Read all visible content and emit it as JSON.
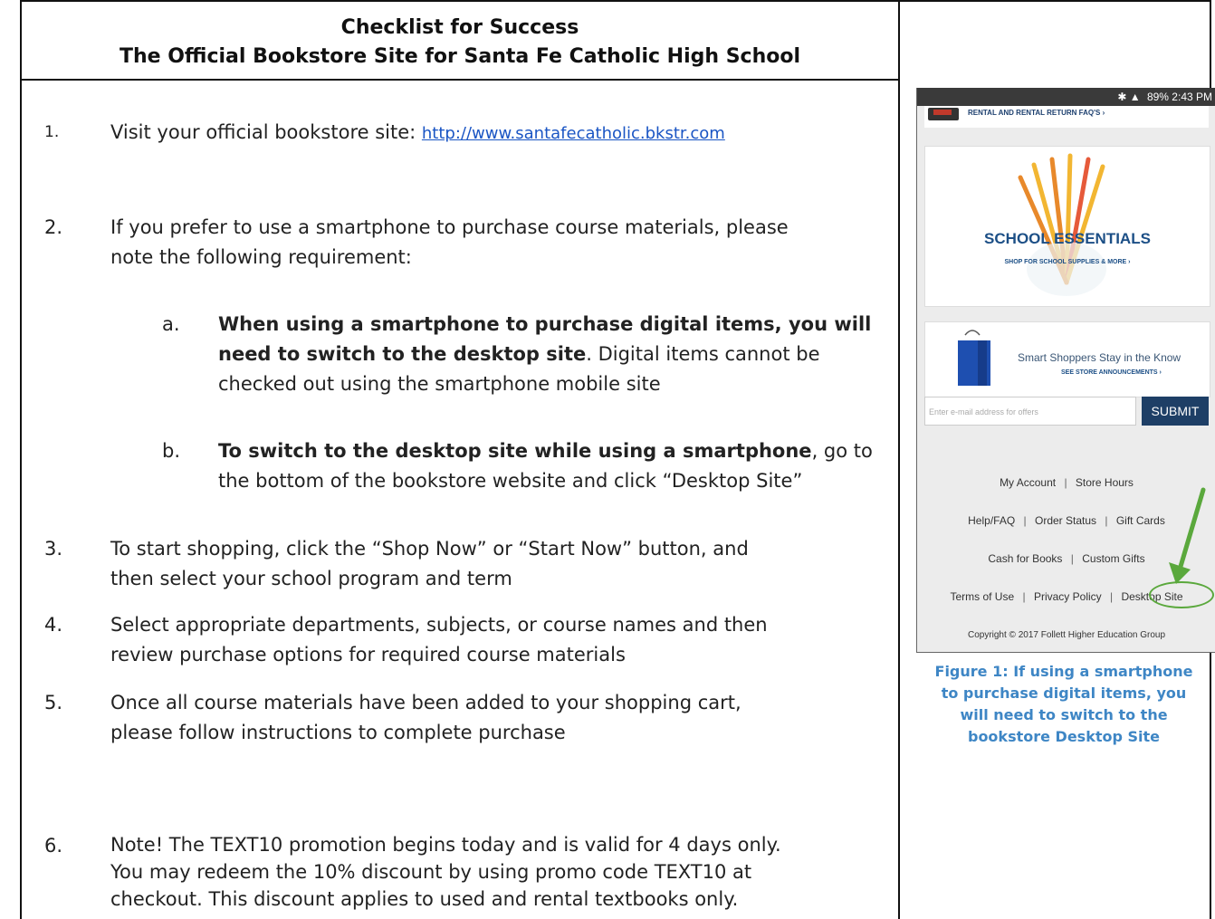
{
  "header": {
    "title_line1": "Checklist for Success",
    "title_line2": "The Official Bookstore Site for Santa Fe Catholic High School"
  },
  "steps": [
    {
      "num": "1.",
      "text": "Visit your official bookstore site: ",
      "link": "http://www.santafecatholic.bkstr.com"
    },
    {
      "num": "2.",
      "line1": "If you prefer to use a smartphone to purchase course materials, please",
      "line2": "note the following requirement:"
    },
    {
      "num": "3.",
      "line1": "To start shopping, click the “Shop Now” or “Start Now” button, and",
      "line2": "then select your school program and term"
    },
    {
      "num": "4.",
      "line1": "Select appropriate departments, subjects, or course names and then",
      "line2": "review purchase options for required course materials"
    },
    {
      "num": "5.",
      "line1": "Once all course materials have been added to your shopping cart,",
      "line2": "please follow instructions to complete purchase"
    },
    {
      "num": "6.",
      "line1": "Note! The TEXT10 promotion begins today and is valid for 4 days only.",
      "line2": "You may redeem the 10% discount by using promo code TEXT10 at",
      "line3": "checkout. This discount applies to used and rental textbooks only."
    }
  ],
  "substeps": [
    {
      "letter": "a.",
      "bold1": "When using a smartphone to purchase digital items, you will",
      "bold2": "need to switch to the desktop site",
      "rest2": ". Digital items cannot be",
      "line3": "checked out using the smartphone mobile site"
    },
    {
      "letter": "b.",
      "bold1": "To switch to the desktop site while using a smartphone",
      "rest1": ", go  to",
      "line2": "the bottom of the bookstore website and click “Desktop Site”"
    }
  ],
  "phone": {
    "status": "89% 2:43 PM",
    "banner_top": "RENTAL AND RENTAL RETURN FAQ'S ›",
    "essentials_title": "SCHOOL ESSENTIALS",
    "essentials_sub": "SHOP FOR SCHOOL SUPPLIES & MORE ›",
    "smart_title": "Smart Shoppers Stay in the Know",
    "smart_sub": "SEE STORE ANNOUNCEMENTS ›",
    "email_placeholder": "Enter e-mail address for offers",
    "submit_label": "SUBMIT",
    "footer_links": {
      "my_account": "My Account",
      "store_hours": "Store Hours",
      "help_faq": "Help/FAQ",
      "order_status": "Order Status",
      "gift_cards": "Gift Cards",
      "cash_for_books": "Cash for Books",
      "custom_gifts": "Custom Gifts",
      "terms": "Terms of Use",
      "privacy": "Privacy Policy",
      "desktop_site": "Desktop Site"
    },
    "separator": "|",
    "copyright": "Copyright © 2017 Follett Higher Education Group"
  },
  "caption": {
    "line1": "Figure 1: If using a smartphone",
    "line2": "to purchase digital items, you",
    "line3": "will need to switch to the",
    "line4": "bookstore Desktop Site"
  },
  "colors": {
    "link": "#1a55c4",
    "caption": "#3e86c5",
    "arrow": "#5aa83c",
    "submit_bg": "#1e3f66"
  }
}
